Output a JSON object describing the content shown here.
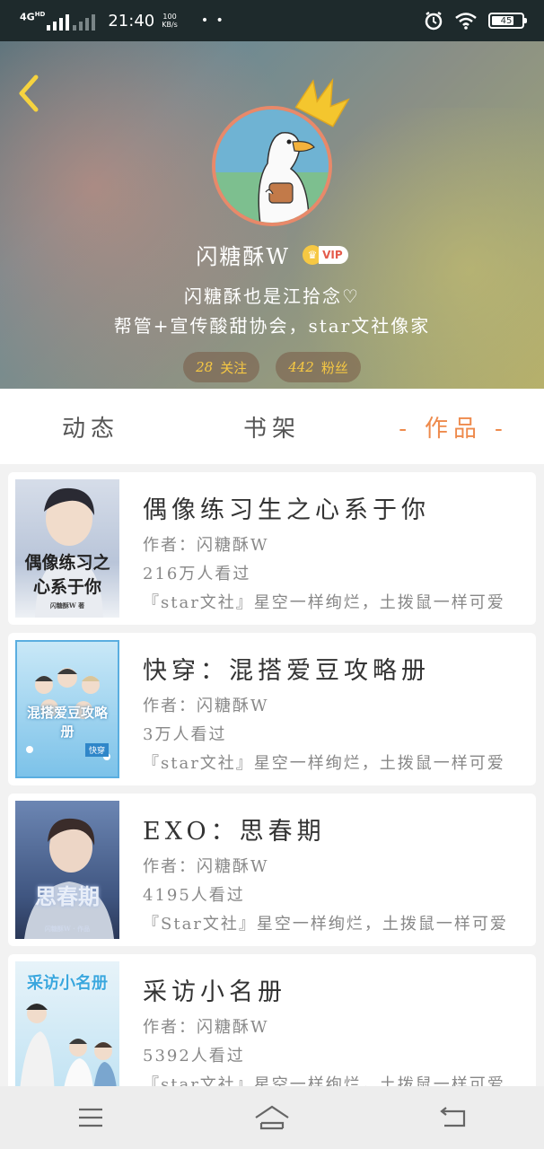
{
  "status_bar": {
    "network": "4G",
    "network_sup": "HD",
    "time": "21:40",
    "speed_value": "100",
    "speed_unit": "KB/s",
    "dots": "• •",
    "battery": "45"
  },
  "profile": {
    "username": "闪糖酥W",
    "vip_label": "VIP",
    "bio_line1": "闪糖酥也是江拾念♡",
    "bio_line2": "帮管+宣传酸甜协会，star文社像家",
    "following_count": "28",
    "following_label": "关注",
    "followers_count": "442",
    "followers_label": "粉丝"
  },
  "tabs": [
    {
      "label": "动态"
    },
    {
      "label": "书架"
    },
    {
      "label": "作品"
    }
  ],
  "works": [
    {
      "title": "偶像练习生之心系于你",
      "author": "作者：闪糖酥W",
      "views": "216万人看过",
      "desc": "『star文社』星空一样绚烂，土拨鼠一样可爱",
      "cover_text": "偶像练习之心系于你",
      "cover_author": "闪糖酥W 著",
      "cover_colors": [
        "#cfd7e6",
        "#8ea0bf"
      ]
    },
    {
      "title": "快穿：混搭爱豆攻略册",
      "author": "作者：闪糖酥W",
      "views": "3万人看过",
      "desc": "『star文社』星空一样绚烂，土拨鼠一样可爱",
      "cover_text": "混搭爱豆攻略册",
      "cover_badge": "快穿",
      "cover_colors": [
        "#a8d8f0",
        "#4aa8df"
      ]
    },
    {
      "title": "EXO：思春期",
      "author": "作者：闪糖酥W",
      "views": "4195人看过",
      "desc": "『Star文社』星空一样绚烂，土拨鼠一样可爱",
      "cover_text": "思春期",
      "cover_author": "闪糖酥W · 作品",
      "cover_colors": [
        "#5d7aa8",
        "#2d3f5f"
      ]
    },
    {
      "title": "采访小名册",
      "author": "作者：闪糖酥W",
      "views": "5392人看过",
      "desc": "『star文社』星空一样绚烂，土拨鼠一样可爱",
      "cover_text": "采访小名册",
      "cover_colors": [
        "#dfeef7",
        "#7fc4e8"
      ]
    }
  ],
  "navbar": {
    "menu_icon": "menu-icon",
    "home_icon": "home-icon",
    "back_icon": "back-icon"
  },
  "colors": {
    "accent": "#ee8a4c",
    "avatar_border": "#e8896a",
    "stat_text": "#f6c843",
    "vip_text": "#e45b4b"
  }
}
